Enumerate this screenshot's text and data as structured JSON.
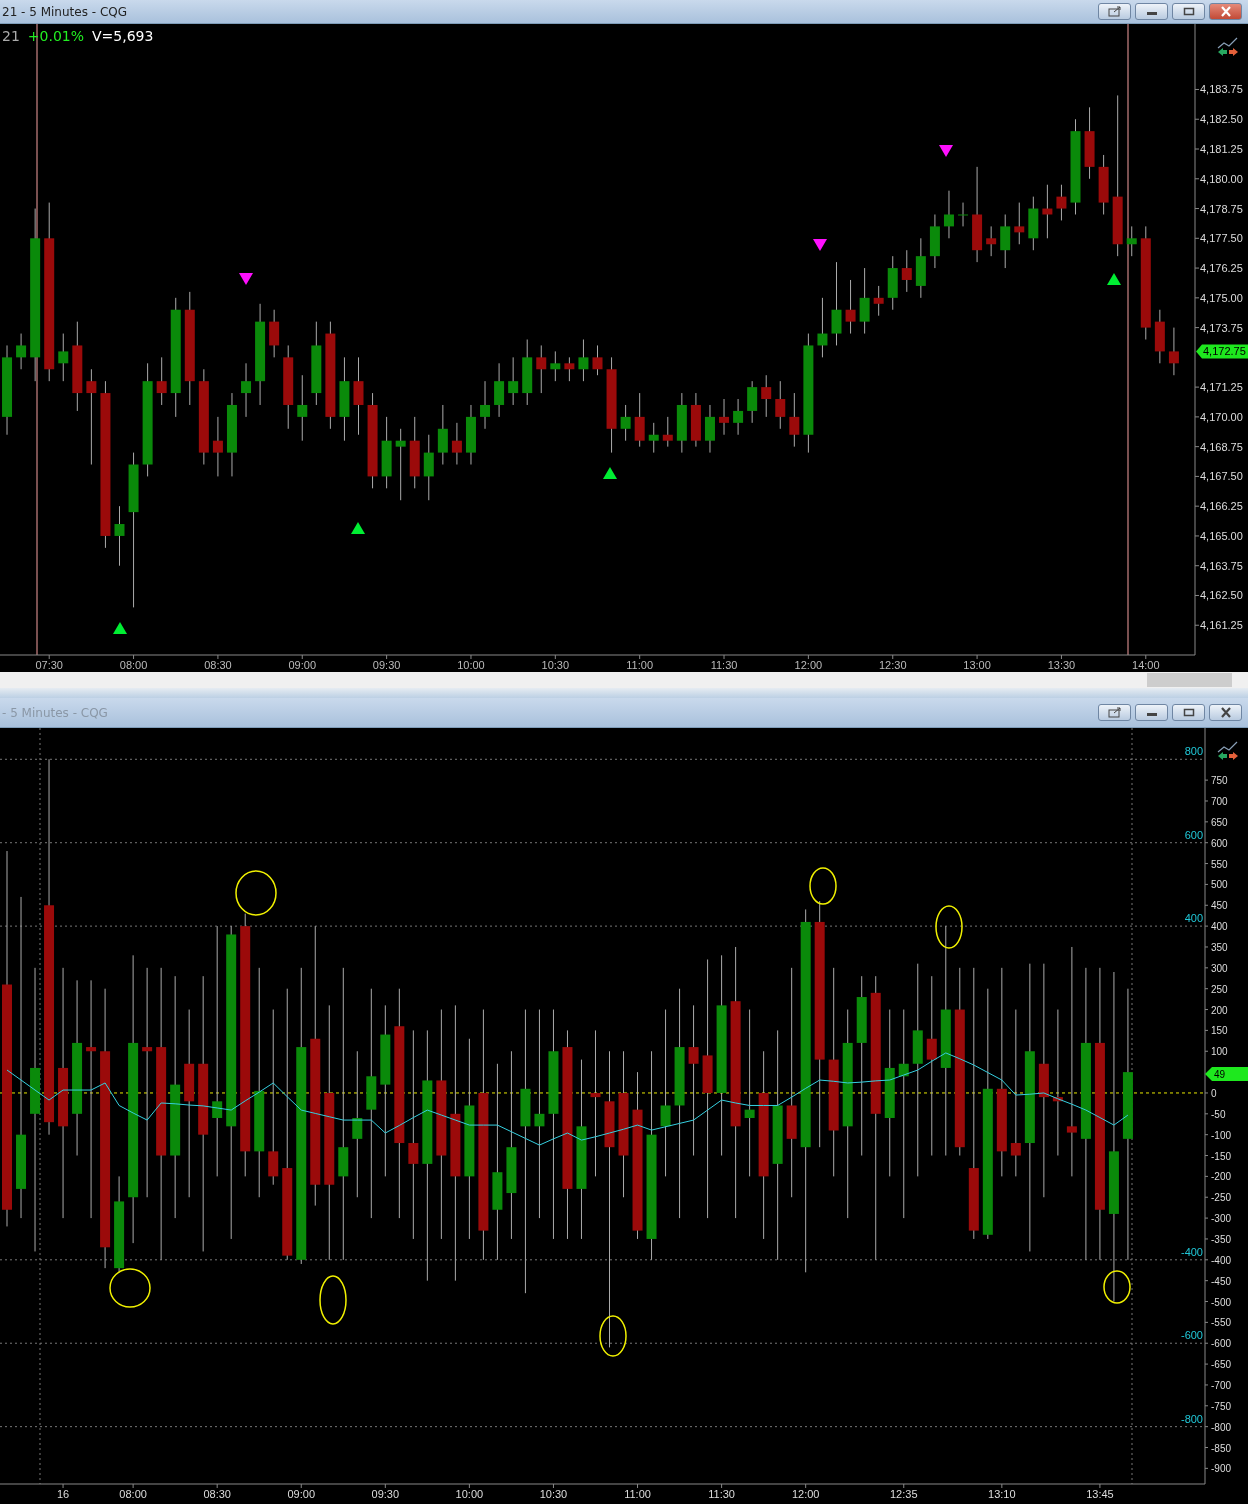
{
  "top_window": {
    "title": "21 - 5 Minutes - CQG",
    "symbol": "21",
    "change": "+0.01%",
    "volume": "V=5,693",
    "last_price": "4,172.75",
    "chart_data": {
      "type": "candlestick",
      "ylim": [
        4160,
        4186.5
      ],
      "categories": [
        null,
        null,
        null,
        "07:30",
        null,
        null,
        null,
        null,
        null,
        "08:00",
        null,
        null,
        null,
        null,
        null,
        "08:30",
        null,
        null,
        null,
        null,
        null,
        "09:00",
        null,
        null,
        null,
        null,
        null,
        "09:30",
        null,
        null,
        null,
        null,
        null,
        "10:00",
        null,
        null,
        null,
        null,
        null,
        "10:30",
        null,
        null,
        null,
        null,
        null,
        "11:00",
        null,
        null,
        null,
        null,
        null,
        "11:30",
        null,
        null,
        null,
        null,
        null,
        "12:00",
        null,
        null,
        null,
        null,
        null,
        "12:30",
        null,
        null,
        null,
        null,
        null,
        "13:00",
        null,
        null,
        null,
        null,
        null,
        "13:30",
        null,
        null,
        null,
        null,
        null,
        "14:00",
        null,
        null,
        null
      ],
      "yticks": [
        {
          "value": 4183.75,
          "label": "4,183.75"
        },
        {
          "value": 4182.5,
          "label": "4,182.50"
        },
        {
          "value": 4181.25,
          "label": "4,181.25"
        },
        {
          "value": 4180,
          "label": "4,180.00"
        },
        {
          "value": 4178.75,
          "label": "4,178.75"
        },
        {
          "value": 4177.5,
          "label": "4,177.50"
        },
        {
          "value": 4176.25,
          "label": "4,176.25"
        },
        {
          "value": 4175,
          "label": "4,175.00"
        },
        {
          "value": 4173.75,
          "label": "4,173.75"
        },
        {
          "value": 4171.25,
          "label": "4,171.25"
        },
        {
          "value": 4170,
          "label": "4,170.00"
        },
        {
          "value": 4168.75,
          "label": "4,168.75"
        },
        {
          "value": 4167.5,
          "label": "4,167.50"
        },
        {
          "value": 4166.25,
          "label": "4,166.25"
        },
        {
          "value": 4165,
          "label": "4,165.00"
        },
        {
          "value": 4163.75,
          "label": "4,163.75"
        },
        {
          "value": 4162.5,
          "label": "4,162.50"
        },
        {
          "value": 4161.25,
          "label": "4,161.25"
        }
      ],
      "ohlc": [
        [
          4170,
          4173,
          4169.25,
          4172.5
        ],
        [
          4172.5,
          4173.5,
          4172,
          4173
        ],
        [
          4172.5,
          4178.75,
          4171.5,
          4177.5
        ],
        [
          4177.5,
          4179,
          4171.5,
          4172
        ],
        [
          4172.25,
          4173.5,
          4171.5,
          4172.75
        ],
        [
          4173,
          4174,
          4170.25,
          4171
        ],
        [
          4171.5,
          4172,
          4168,
          4171
        ],
        [
          4171,
          4171.5,
          4164.5,
          4165
        ],
        [
          4165,
          4166.25,
          4163.75,
          4165.5
        ],
        [
          4166,
          4168.5,
          4162,
          4168
        ],
        [
          4168,
          4172.25,
          4167.5,
          4171.5
        ],
        [
          4171.5,
          4172.5,
          4170.5,
          4171
        ],
        [
          4171,
          4175,
          4170,
          4174.5
        ],
        [
          4174.5,
          4175.25,
          4170.5,
          4171.5
        ],
        [
          4171.5,
          4172,
          4168,
          4168.5
        ],
        [
          4169,
          4170,
          4167.5,
          4168.5
        ],
        [
          4168.5,
          4171,
          4167.5,
          4170.5
        ],
        [
          4171,
          4172.25,
          4170,
          4171.5
        ],
        [
          4171.5,
          4174.75,
          4170.5,
          4174
        ],
        [
          4174,
          4174.5,
          4172.5,
          4173
        ],
        [
          4172.5,
          4173,
          4169.5,
          4170.5
        ],
        [
          4170,
          4171.75,
          4169,
          4170.5
        ],
        [
          4171,
          4174,
          4170.5,
          4173
        ],
        [
          4173.5,
          4174,
          4169.5,
          4170
        ],
        [
          4170,
          4172.5,
          4169,
          4171.5
        ],
        [
          4171.5,
          4172.5,
          4169.25,
          4170.5
        ],
        [
          4170.5,
          4171,
          4167,
          4167.5
        ],
        [
          4167.5,
          4170,
          4167,
          4169
        ],
        [
          4168.75,
          4169.5,
          4166.5,
          4169
        ],
        [
          4169,
          4170,
          4167,
          4167.5
        ],
        [
          4167.5,
          4169.25,
          4166.5,
          4168.5
        ],
        [
          4168.5,
          4170.5,
          4168,
          4169.5
        ],
        [
          4169,
          4169.75,
          4168,
          4168.5
        ],
        [
          4168.5,
          4170.5,
          4168,
          4170
        ],
        [
          4170,
          4171.5,
          4169.5,
          4170.5
        ],
        [
          4170.5,
          4172.25,
          4170,
          4171.5
        ],
        [
          4171,
          4172.5,
          4170.5,
          4171.5
        ],
        [
          4171,
          4173.25,
          4170.5,
          4172.5
        ],
        [
          4172.5,
          4173,
          4171,
          4172
        ],
        [
          4172,
          4172.75,
          4171.5,
          4172.25
        ],
        [
          4172.25,
          4172.5,
          4171.5,
          4172
        ],
        [
          4172,
          4173.25,
          4171.5,
          4172.5
        ],
        [
          4172.5,
          4173,
          4171.75,
          4172
        ],
        [
          4172,
          4172.5,
          4168.5,
          4169.5
        ],
        [
          4169.5,
          4170.5,
          4169,
          4170
        ],
        [
          4170,
          4171,
          4168.75,
          4169
        ],
        [
          4169,
          4169.75,
          4168.5,
          4169.25
        ],
        [
          4169.25,
          4170,
          4168.75,
          4169
        ],
        [
          4169,
          4171,
          4168.5,
          4170.5
        ],
        [
          4170.5,
          4171,
          4168.75,
          4169
        ],
        [
          4169,
          4170.5,
          4168.5,
          4170
        ],
        [
          4170,
          4170.75,
          4169.25,
          4169.75
        ],
        [
          4169.75,
          4170.75,
          4169.25,
          4170.25
        ],
        [
          4170.25,
          4171.5,
          4169.75,
          4171.25
        ],
        [
          4171.25,
          4171.75,
          4170,
          4170.75
        ],
        [
          4170.75,
          4171.5,
          4169.5,
          4170
        ],
        [
          4170,
          4171,
          4168.75,
          4169.25
        ],
        [
          4169.25,
          4173.5,
          4168.5,
          4173
        ],
        [
          4173,
          4175,
          4172.5,
          4173.5
        ],
        [
          4173.5,
          4176.5,
          4173,
          4174.5
        ],
        [
          4174.5,
          4175.75,
          4173.5,
          4174
        ],
        [
          4174,
          4176.25,
          4173.5,
          4175
        ],
        [
          4175,
          4175.5,
          4174.25,
          4174.75
        ],
        [
          4175,
          4176.75,
          4174.5,
          4176.25
        ],
        [
          4176.25,
          4177,
          4175.25,
          4175.75
        ],
        [
          4175.5,
          4177.5,
          4175,
          4176.75
        ],
        [
          4176.75,
          4178.5,
          4176.25,
          4178
        ],
        [
          4178,
          4179.5,
          4177.5,
          4178.5
        ],
        [
          4178.5,
          4179,
          4178,
          4178.5
        ],
        [
          4178.5,
          4180.5,
          4176.5,
          4177
        ],
        [
          4177.5,
          4178,
          4176.75,
          4177.25
        ],
        [
          4177,
          4178.5,
          4176.25,
          4178
        ],
        [
          4178,
          4179,
          4177.25,
          4177.75
        ],
        [
          4177.5,
          4179.25,
          4177,
          4178.75
        ],
        [
          4178.75,
          4179.75,
          4177.5,
          4178.5
        ],
        [
          4179.25,
          4179.75,
          4178.25,
          4178.75
        ],
        [
          4179,
          4182.5,
          4178.5,
          4182
        ],
        [
          4182,
          4183,
          4180,
          4180.5
        ],
        [
          4180.5,
          4181,
          4178.5,
          4179
        ],
        [
          4179.25,
          4183.5,
          4176.75,
          4177.25
        ],
        [
          4177.25,
          4178,
          4176.75,
          4177.5
        ],
        [
          4177.5,
          4178,
          4173.25,
          4173.75
        ],
        [
          4174,
          4174.5,
          4172.25,
          4172.75
        ],
        [
          4172.75,
          4173.75,
          4171.75,
          4172.25
        ],
        null
      ]
    }
  },
  "bottom_window": {
    "title": "- 5 Minutes - CQG",
    "last_value": "49",
    "chart_data": {
      "type": "candlestick",
      "ylim": [
        -937.5,
        875
      ],
      "categories": [
        null,
        null,
        null,
        null,
        "16",
        null,
        null,
        null,
        null,
        "08:00",
        null,
        null,
        null,
        null,
        null,
        "08:30",
        null,
        null,
        null,
        null,
        null,
        "09:00",
        null,
        null,
        null,
        null,
        null,
        "09:30",
        null,
        null,
        null,
        null,
        null,
        "10:00",
        null,
        null,
        null,
        null,
        null,
        "10:30",
        null,
        null,
        null,
        null,
        null,
        "11:00",
        null,
        null,
        null,
        null,
        null,
        "11:30",
        null,
        null,
        null,
        null,
        null,
        "12:00",
        null,
        null,
        null,
        null,
        null,
        null,
        "12:35",
        null,
        null,
        null,
        null,
        null,
        null,
        "13:10",
        null,
        null,
        null,
        null,
        null,
        null,
        "13:45",
        null,
        null,
        null,
        null,
        null,
        null,
        null
      ],
      "yticks": [
        {
          "value": 750,
          "label": "750"
        },
        {
          "value": 700,
          "label": "700"
        },
        {
          "value": 650,
          "label": "650"
        },
        {
          "value": 600,
          "label": "600"
        },
        {
          "value": 550,
          "label": "550"
        },
        {
          "value": 500,
          "label": "500"
        },
        {
          "value": 450,
          "label": "450"
        },
        {
          "value": 400,
          "label": "400"
        },
        {
          "value": 350,
          "label": "350"
        },
        {
          "value": 300,
          "label": "300"
        },
        {
          "value": 250,
          "label": "250"
        },
        {
          "value": 200,
          "label": "200"
        },
        {
          "value": 150,
          "label": "150"
        },
        {
          "value": 100,
          "label": "100"
        },
        {
          "value": 0,
          "label": "0"
        },
        {
          "value": -50,
          "label": "-50"
        },
        {
          "value": -100,
          "label": "-100"
        },
        {
          "value": -150,
          "label": "-150"
        },
        {
          "value": -200,
          "label": "-200"
        },
        {
          "value": -250,
          "label": "-250"
        },
        {
          "value": -300,
          "label": "-300"
        },
        {
          "value": -350,
          "label": "-350"
        },
        {
          "value": -400,
          "label": "-400"
        },
        {
          "value": -450,
          "label": "-450"
        },
        {
          "value": -500,
          "label": "-500"
        },
        {
          "value": -550,
          "label": "-550"
        },
        {
          "value": -600,
          "label": "-600"
        },
        {
          "value": -650,
          "label": "-650"
        },
        {
          "value": -700,
          "label": "-700"
        },
        {
          "value": -750,
          "label": "-750"
        },
        {
          "value": -800,
          "label": "-800"
        },
        {
          "value": -850,
          "label": "-850"
        },
        {
          "value": -900,
          "label": "-900"
        }
      ],
      "grid": true,
      "ref_lines": [
        {
          "axis": "y",
          "value": 800,
          "label": "800"
        },
        {
          "axis": "y",
          "value": 600,
          "label": "600"
        },
        {
          "axis": "y",
          "value": 400,
          "label": "400"
        },
        {
          "axis": "y",
          "value": -400,
          "label": "-400"
        },
        {
          "axis": "y",
          "value": -600,
          "label": "-600"
        },
        {
          "axis": "y",
          "value": -800,
          "label": "-800"
        },
        {
          "axis": "y",
          "value": 0,
          "color": "#e8e800"
        }
      ],
      "ohlc": [
        [
          260,
          580,
          -320,
          -280
        ],
        [
          -230,
          470,
          -300,
          -100
        ],
        [
          -50,
          300,
          -380,
          60
        ],
        [
          450,
          800,
          -100,
          -70
        ],
        [
          60,
          300,
          -300,
          -80
        ],
        [
          -50,
          270,
          -150,
          120
        ],
        [
          110,
          270,
          -300,
          100
        ],
        [
          100,
          250,
          -420,
          -370
        ],
        [
          -420,
          -200,
          -430,
          -260
        ],
        [
          -250,
          330,
          -360,
          120
        ],
        [
          110,
          300,
          -250,
          100
        ],
        [
          110,
          300,
          -400,
          -150
        ],
        [
          -150,
          280,
          -300,
          20
        ],
        [
          70,
          200,
          -250,
          -20
        ],
        [
          70,
          280,
          -380,
          -100
        ],
        [
          -60,
          400,
          -200,
          -20
        ],
        [
          -80,
          400,
          -350,
          380
        ],
        [
          400,
          430,
          -200,
          -140
        ],
        [
          -140,
          300,
          -250,
          5
        ],
        [
          -140,
          200,
          -220,
          -200
        ],
        [
          -180,
          250,
          -400,
          -390
        ],
        [
          -400,
          300,
          -410,
          110
        ],
        [
          130,
          400,
          -270,
          -220
        ],
        [
          0,
          210,
          -400,
          -220
        ],
        [
          -200,
          300,
          -400,
          -130
        ],
        [
          -110,
          100,
          -250,
          -60
        ],
        [
          -40,
          250,
          -300,
          40
        ],
        [
          20,
          210,
          -200,
          140
        ],
        [
          160,
          250,
          -300,
          -120
        ],
        [
          -120,
          150,
          -350,
          -170
        ],
        [
          -170,
          150,
          -450,
          30
        ],
        [
          30,
          200,
          -350,
          -150
        ],
        [
          -50,
          210,
          -450,
          -200
        ],
        [
          -200,
          130,
          -350,
          -30
        ],
        [
          0,
          200,
          -400,
          -330
        ],
        [
          -280,
          70,
          -400,
          -190
        ],
        [
          -240,
          100,
          -350,
          -130
        ],
        [
          -80,
          200,
          -480,
          10
        ],
        [
          -80,
          200,
          -300,
          -50
        ],
        [
          -50,
          200,
          -350,
          100
        ],
        [
          110,
          150,
          -350,
          -230
        ],
        [
          -230,
          80,
          -350,
          -80
        ],
        [
          0,
          150,
          -200,
          -10
        ],
        [
          -20,
          100,
          -610,
          -130
        ],
        [
          0,
          100,
          -250,
          -150
        ],
        [
          -40,
          50,
          -350,
          -330
        ],
        [
          -350,
          100,
          -400,
          -100
        ],
        [
          -80,
          200,
          -200,
          -30
        ],
        [
          -30,
          250,
          -300,
          110
        ],
        [
          110,
          210,
          -150,
          70
        ],
        [
          90,
          320,
          -300,
          0
        ],
        [
          0,
          330,
          -150,
          210
        ],
        [
          220,
          350,
          -300,
          -80
        ],
        [
          -60,
          200,
          -200,
          -40
        ],
        [
          0,
          100,
          -350,
          -200
        ],
        [
          -170,
          150,
          -400,
          -30
        ],
        [
          -30,
          300,
          -250,
          -110
        ],
        [
          -130,
          440,
          -430,
          410
        ],
        [
          410,
          460,
          -130,
          80
        ],
        [
          80,
          300,
          -200,
          -90
        ],
        [
          -80,
          200,
          -300,
          120
        ],
        [
          120,
          280,
          -150,
          230
        ],
        [
          240,
          280,
          -400,
          -50
        ],
        [
          -60,
          200,
          -200,
          60
        ],
        [
          40,
          200,
          -300,
          70
        ],
        [
          70,
          310,
          -200,
          150
        ],
        [
          130,
          280,
          -150,
          80
        ],
        [
          60,
          400,
          -150,
          200
        ],
        [
          200,
          300,
          -150,
          -130
        ],
        [
          -180,
          300,
          -350,
          -330
        ],
        [
          -340,
          250,
          -350,
          10
        ],
        [
          10,
          300,
          -200,
          -140
        ],
        [
          -120,
          200,
          -200,
          -150
        ],
        [
          -120,
          310,
          -380,
          100
        ],
        [
          70,
          310,
          -250,
          -10
        ],
        [
          -10,
          200,
          -150,
          -20
        ],
        [
          -80,
          350,
          -200,
          -95
        ],
        [
          -110,
          300,
          -400,
          120
        ],
        [
          120,
          300,
          -400,
          -280
        ],
        [
          -290,
          290,
          -500,
          -140
        ],
        [
          -110,
          250,
          -400,
          50
        ],
        null,
        null,
        null,
        null,
        null
      ],
      "series": [
        {
          "type": "line",
          "color": "#35d0e0",
          "values": [
            55,
            31,
            7,
            -17,
            7,
            7,
            7,
            24,
            -30,
            -48,
            -65,
            -24,
            -26,
            -29,
            -31,
            -36,
            -41,
            -19,
            2,
            24,
            -9,
            -41,
            -49,
            -57,
            -65,
            -65,
            -65,
            -96,
            -78,
            -59,
            -41,
            -53,
            -65,
            -77,
            -77,
            -77,
            -93,
            -109,
            -125,
            -110,
            -96,
            -113,
            -105,
            -96,
            -87,
            -77,
            -89,
            -81,
            -73,
            -65,
            -41,
            -17,
            -24,
            -30,
            -30,
            -30,
            -10,
            11,
            31,
            28,
            24,
            26,
            29,
            31,
            43,
            55,
            76,
            96,
            82,
            67,
            49,
            31,
            -5,
            -3,
            0,
            -14,
            -27,
            -41,
            -59,
            -77,
            -53,
            null,
            null,
            null,
            null,
            null
          ]
        }
      ]
    }
  }
}
